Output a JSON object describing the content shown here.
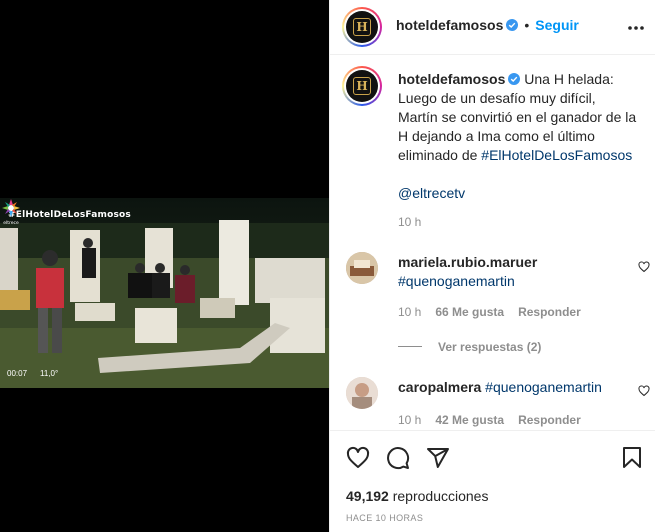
{
  "video": {
    "hashtag_overlay": "#ElHotelDeLosFamosos",
    "time_left": "00:07",
    "time_right": "11,0°",
    "channel": "eltrece"
  },
  "header": {
    "username": "hoteldefamosos",
    "separator": "•",
    "follow_label": "Seguir",
    "avatar_letter": "H"
  },
  "caption": {
    "username": "hoteldefamosos",
    "text": "Una H helada: Luego de un desafío muy difícil, Martín se convirtió en el ganador de la H dejando a Ima como el último eliminado de ",
    "hashtag": "#ElHotelDeLosFamosos",
    "mention": "@eltrecetv",
    "time": "10 h"
  },
  "comments": [
    {
      "username": "mariela.rubio.maruer",
      "hashtag": "#quenoganemartin",
      "time": "10 h",
      "likes": "66 Me gusta",
      "reply": "Responder",
      "view_replies": "Ver respuestas (2)"
    },
    {
      "username": "caropalmera",
      "hashtag": "#quenoganemartin",
      "time": "10 h",
      "likes": "42 Me gusta",
      "reply": "Responder"
    }
  ],
  "footer": {
    "views_count": "49,192",
    "views_label": "reproducciones",
    "time_ago": "HACE 10 HORAS"
  },
  "icons": {
    "like": "heart-icon",
    "comment": "comment-icon",
    "share": "share-icon",
    "save": "bookmark-icon",
    "more": "more-icon",
    "verified": "verified-badge-icon"
  },
  "colors": {
    "link_blue": "#0095f6",
    "hashtag": "#00376b",
    "secondary_text": "#8e8e8e",
    "verified": "#3897f0"
  }
}
